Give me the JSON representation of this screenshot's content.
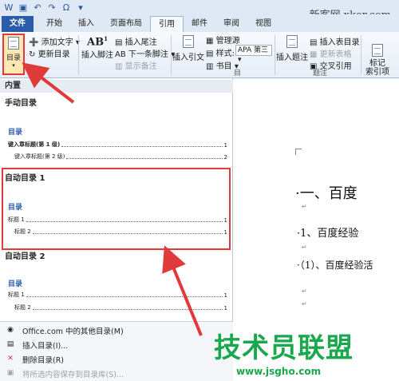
{
  "watermark_top": "新客网 xker.com",
  "tabs": [
    "文件",
    "开始",
    "插入",
    "页面布局",
    "引用",
    "邮件",
    "审阅",
    "视图"
  ],
  "ribbon": {
    "toc_label": "目录",
    "add_text": "添加文字",
    "update_toc": "更新目录",
    "insert_footnote": "插入脚注",
    "insert_endnote": "插入尾注",
    "next_footnote": "下一条脚注",
    "show_notes": "显示备注",
    "insert_citation": "插入引文",
    "manage_sources": "管理源",
    "style_label": "样式:",
    "style_value": "APA 第三",
    "bibliography": "书目",
    "insert_caption": "插入题注",
    "insert_table_of_figures": "插入表目录",
    "update_table": "更新表格",
    "cross_reference": "交叉引用",
    "caption_group": "题注",
    "mark_entry": "标记\n索引项",
    "group_end": "目"
  },
  "dropdown": {
    "builtin_header": "内置",
    "manual_title": "手动目录",
    "manual_mini_title": "目录",
    "manual_row1": "键入章标题(第 1 级)",
    "manual_row1_num": "1",
    "manual_row2": "键入章标题(第 2 级)",
    "manual_row2_num": "2",
    "auto1_title": "自动目录 1",
    "auto1_mini_title": "目录",
    "auto1_row1": "标题 1",
    "auto1_row1_num": "1",
    "auto1_row2": "标题 2",
    "auto1_row2_num": "1",
    "auto2_title": "自动目录 2",
    "auto2_mini_title": "目录",
    "auto2_row1": "标题 1",
    "auto2_row1_num": "1",
    "auto2_row2": "标题 2",
    "auto2_row2_num": "1",
    "menu": [
      {
        "label": "Office.com 中的其他目录(M)",
        "disabled": false
      },
      {
        "label": "插入目录(I)...",
        "disabled": false
      },
      {
        "label": "删除目录(R)",
        "disabled": false
      },
      {
        "label": "将所选内容保存到目录库(S)...",
        "disabled": true
      }
    ]
  },
  "document": {
    "heading1": "·一、百度",
    "heading2": "·1、百度经验",
    "heading3": "·（1）、百度经验活"
  },
  "watermark_bottom": "技术员联盟",
  "watermark_url": "www.jsgho.com",
  "colors": {
    "highlight_red": "#e03a3a",
    "file_tab": "#2a5caa",
    "watermark_green": "#1aa84c"
  }
}
